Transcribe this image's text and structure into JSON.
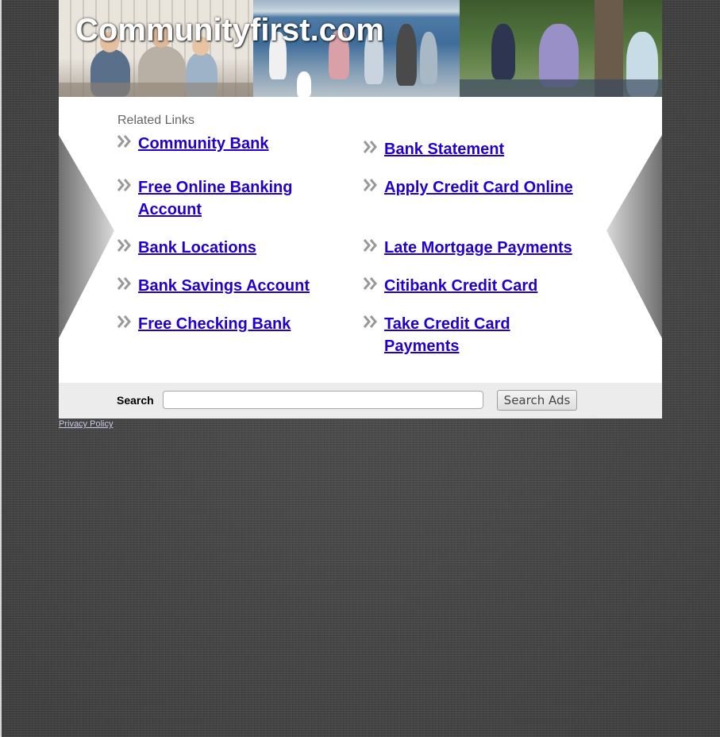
{
  "header": {
    "site_title": "Communityfirst.com"
  },
  "main": {
    "related_label": "Related Links",
    "left_links": [
      {
        "label": "Community Bank"
      },
      {
        "label": "Free Online Banking Account"
      },
      {
        "label": "Bank Locations"
      },
      {
        "label": "Bank Savings Account"
      },
      {
        "label": "Free Checking Bank"
      }
    ],
    "right_links": [
      {
        "label": "Bank Statement"
      },
      {
        "label": "Apply Credit Card Online"
      },
      {
        "label": "Late Mortgage Payments"
      },
      {
        "label": "Citibank Credit Card"
      },
      {
        "label": "Take Credit Card Payments"
      }
    ]
  },
  "search": {
    "label": "Search",
    "input_value": "",
    "button_label": "Search Ads"
  },
  "footer": {
    "privacy_label": "Privacy Policy"
  },
  "colors": {
    "link": "#2200cc",
    "background": "#444444",
    "search_bar": "#ececec",
    "chevron": "#999999"
  },
  "icons": {
    "chevron": "double-chevron-right-icon"
  }
}
